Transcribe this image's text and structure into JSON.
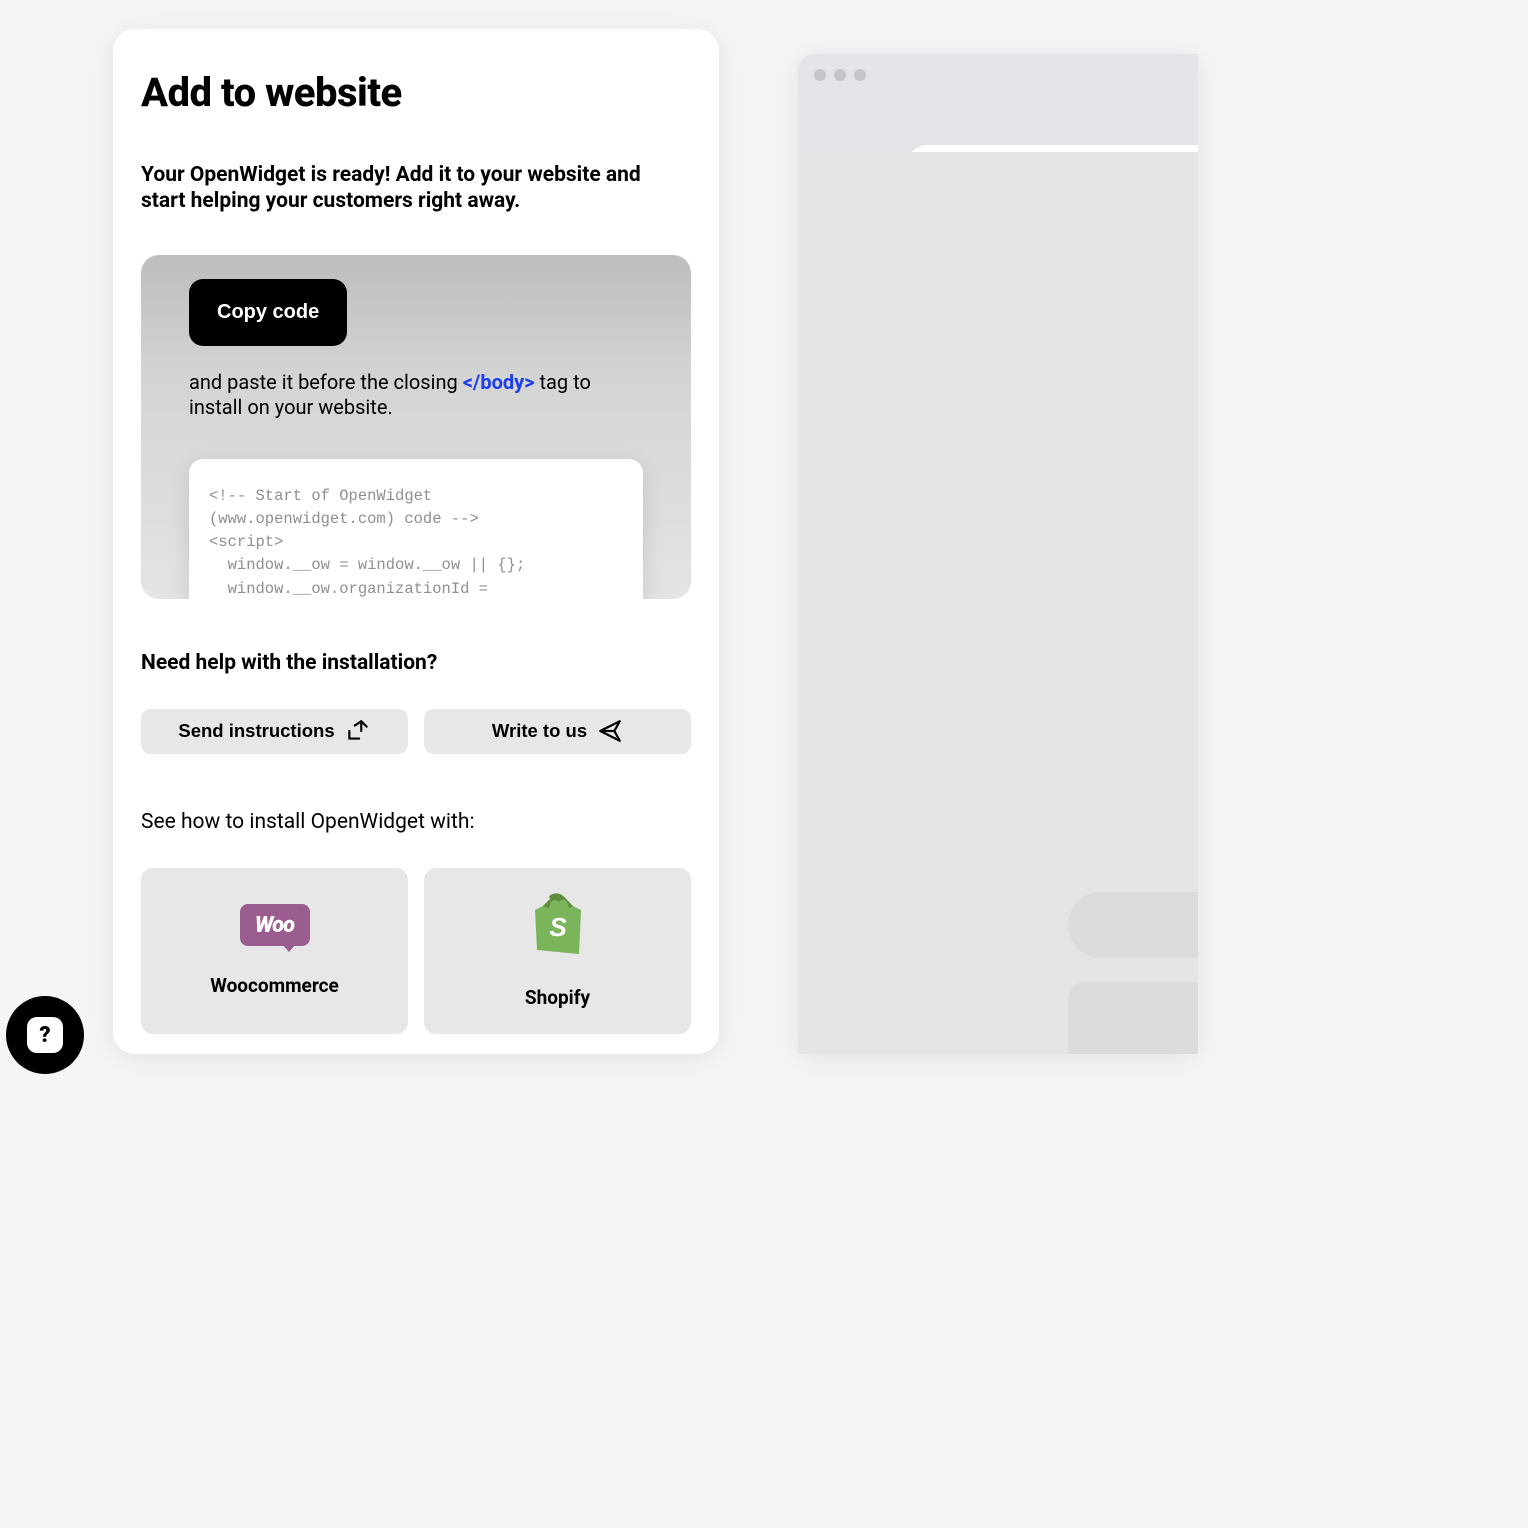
{
  "page": {
    "title": "Add to website",
    "subtitle": "Your OpenWidget is ready! Add it to your website and start helping your customers right away."
  },
  "codePanel": {
    "copy_label": "Copy code",
    "paste_prefix": "and paste it before the closing ",
    "body_tag": "</body>",
    "paste_suffix": " tag to install on your website.",
    "snippet": "<!-- Start of OpenWidget\n(www.openwidget.com) code -->\n<script>\n  window.__ow = window.__ow || {};\n  window.__ow.organizationId ="
  },
  "help": {
    "title": "Need help with the installation?",
    "send_label": "Send instructions",
    "write_label": "Write to us"
  },
  "platforms": {
    "intro": "See how to install OpenWidget with:",
    "items": [
      {
        "label": "Woocommerce",
        "logo_text": "Woo"
      },
      {
        "label": "Shopify",
        "logo_letter": "S"
      }
    ]
  },
  "helpBubble": {
    "glyph": "?"
  }
}
